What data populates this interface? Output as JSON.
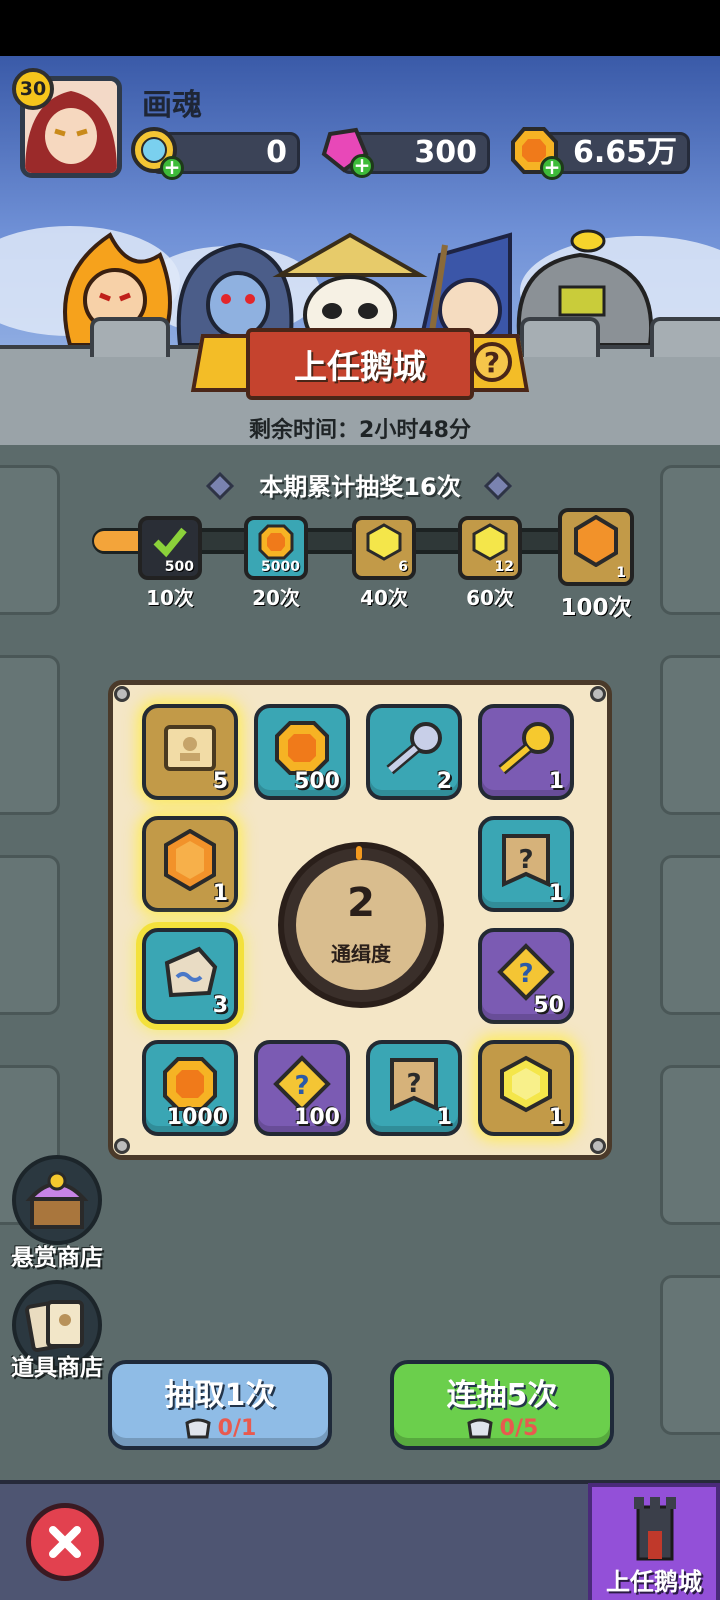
{
  "player": {
    "level": "30",
    "name": "画魂"
  },
  "resources": [
    {
      "icon": "diamond-coin-icon",
      "value": "0"
    },
    {
      "icon": "pink-gem-icon",
      "value": "300"
    },
    {
      "icon": "gold-coin-icon",
      "value": "6.65万"
    }
  ],
  "event": {
    "title": "上任鹅城",
    "help": "?",
    "timer": "剩余时间：2小时48分"
  },
  "progress": {
    "title": "本期累计抽奖16次",
    "current_draws": 16,
    "max_draws": 100,
    "milestones": [
      {
        "label": "10次",
        "qty": "500",
        "icon": "claimed-check-icon",
        "claimed": true
      },
      {
        "label": "20次",
        "qty": "5000",
        "icon": "gold-coin-icon",
        "claimed": false
      },
      {
        "label": "40次",
        "qty": "6",
        "icon": "yellow-gem-icon",
        "claimed": false
      },
      {
        "label": "60次",
        "qty": "12",
        "icon": "yellow-gem-icon",
        "claimed": false
      },
      {
        "label": "100次",
        "qty": "1",
        "icon": "orange-gem-icon",
        "claimed": false
      }
    ]
  },
  "board": {
    "wanted_level": "2",
    "wanted_label": "通缉度",
    "tiles": [
      {
        "icon": "scroll-icon",
        "qty": "5"
      },
      {
        "icon": "gold-coin-icon",
        "qty": "500"
      },
      {
        "icon": "silver-key-icon",
        "qty": "2"
      },
      {
        "icon": "gold-key-icon",
        "qty": "1"
      },
      {
        "icon": "orange-gem-icon",
        "qty": "1"
      },
      {
        "icon": "mystery-banner-icon",
        "qty": "1"
      },
      {
        "icon": "rune-stone-icon",
        "qty": "3"
      },
      {
        "icon": "puzzle-piece-icon",
        "qty": "50"
      },
      {
        "icon": "gold-coin-icon",
        "qty": "1000"
      },
      {
        "icon": "puzzle-piece-icon",
        "qty": "100"
      },
      {
        "icon": "mystery-banner-icon",
        "qty": "1"
      },
      {
        "icon": "yellow-gem-icon",
        "qty": "1"
      }
    ]
  },
  "shops": {
    "bounty": "悬赏商店",
    "items": "道具商店"
  },
  "actions": {
    "draw_one": {
      "label": "抽取1次",
      "cost": "0/1"
    },
    "draw_five": {
      "label": "连抽5次",
      "cost": "0/5"
    }
  },
  "nav": {
    "castle": "上任鹅城"
  }
}
